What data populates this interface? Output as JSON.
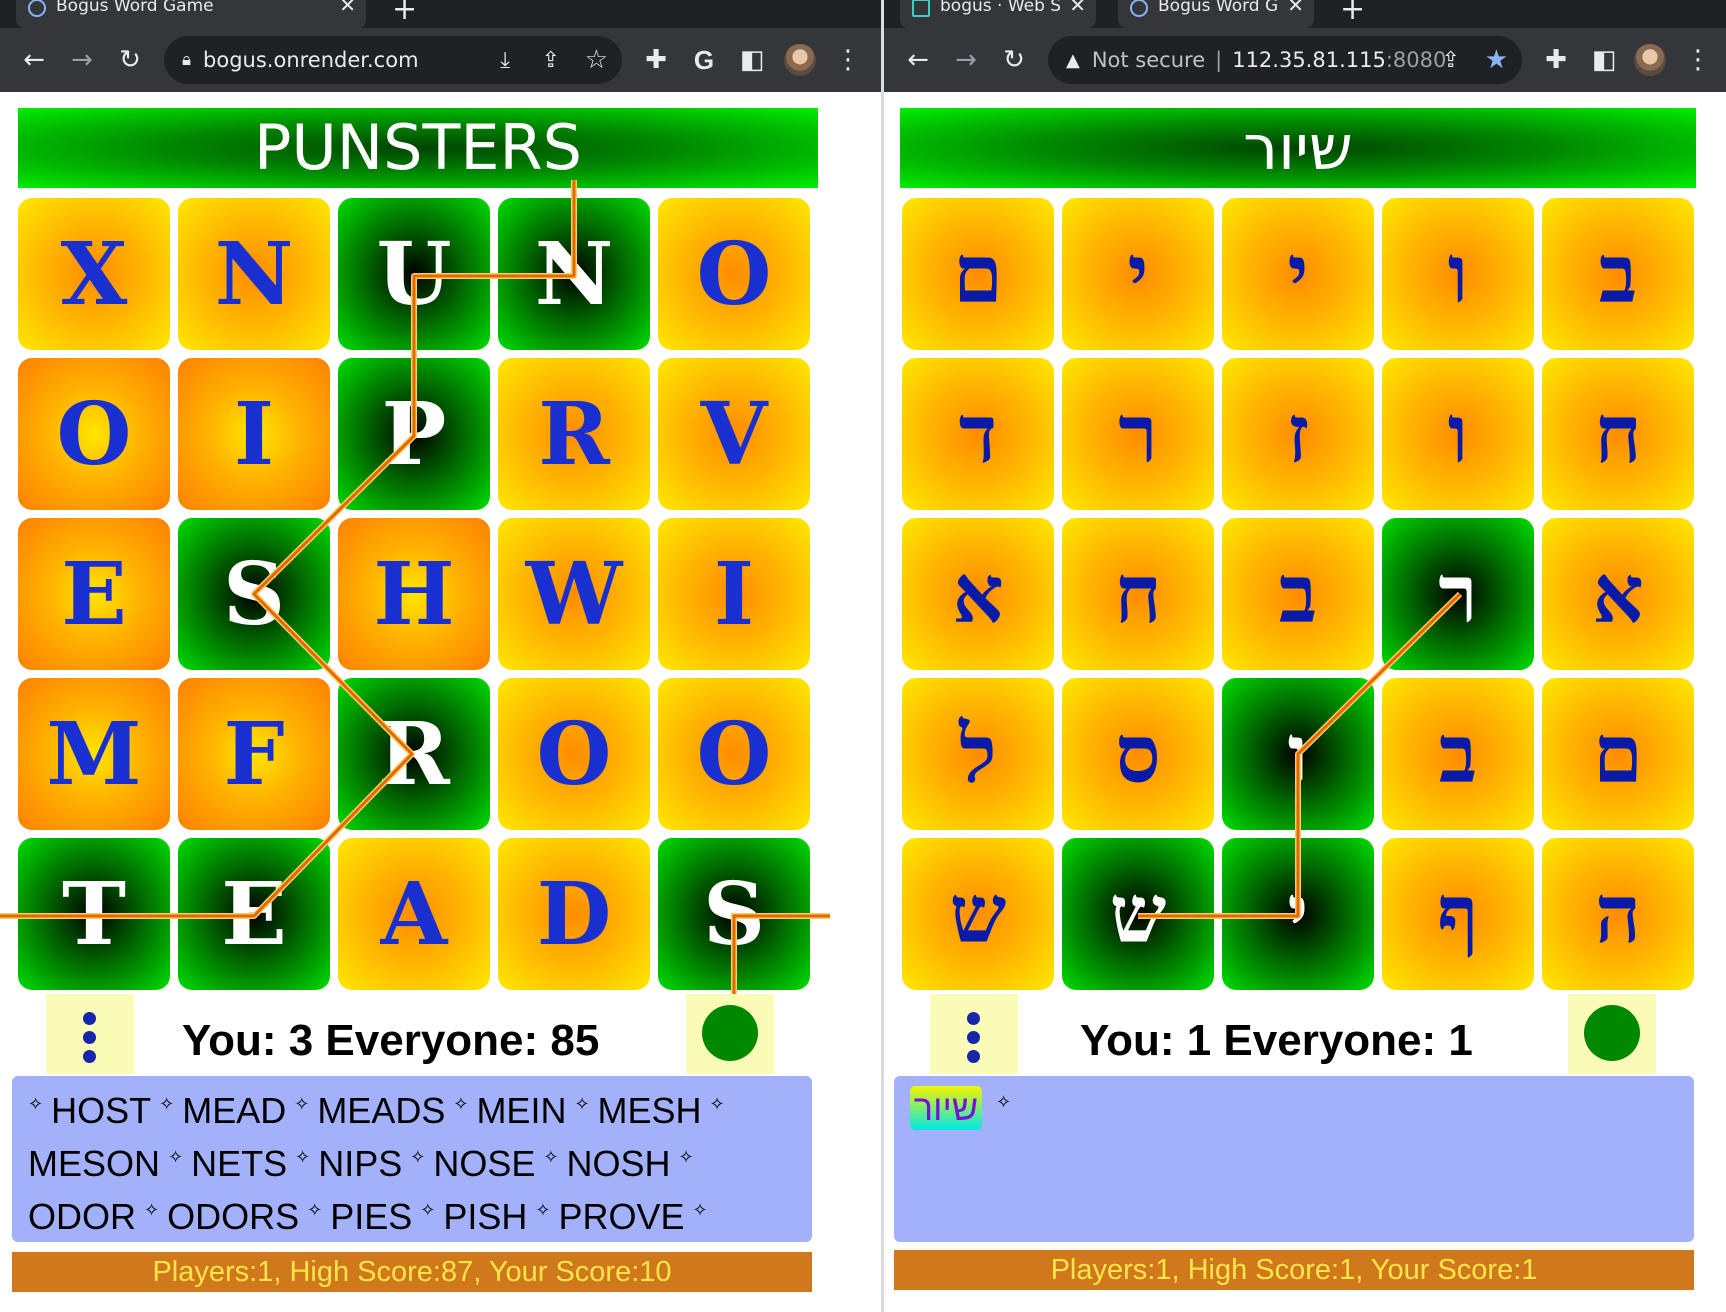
{
  "left": {
    "tabs": [
      {
        "title": "Bogus Word Game"
      }
    ],
    "url": "bogus.onrender.com",
    "game": {
      "title": "PUNSTERS",
      "grid": [
        [
          {
            "l": "X",
            "s": "yellow"
          },
          {
            "l": "N",
            "s": "yellow"
          },
          {
            "l": "U",
            "s": "green"
          },
          {
            "l": "N",
            "s": "green"
          },
          {
            "l": "O",
            "s": "yellow"
          }
        ],
        [
          {
            "l": "O",
            "s": "orange"
          },
          {
            "l": "I",
            "s": "orange"
          },
          {
            "l": "P",
            "s": "green"
          },
          {
            "l": "R",
            "s": "yellow"
          },
          {
            "l": "V",
            "s": "yellow"
          }
        ],
        [
          {
            "l": "E",
            "s": "orange"
          },
          {
            "l": "S",
            "s": "green"
          },
          {
            "l": "H",
            "s": "orange"
          },
          {
            "l": "W",
            "s": "yellow"
          },
          {
            "l": "I",
            "s": "yellow"
          }
        ],
        [
          {
            "l": "M",
            "s": "orange"
          },
          {
            "l": "F",
            "s": "orange"
          },
          {
            "l": "R",
            "s": "green"
          },
          {
            "l": "O",
            "s": "yellow"
          },
          {
            "l": "O",
            "s": "yellow"
          }
        ],
        [
          {
            "l": "T",
            "s": "green"
          },
          {
            "l": "E",
            "s": "green"
          },
          {
            "l": "A",
            "s": "yellow"
          },
          {
            "l": "D",
            "s": "yellow"
          },
          {
            "l": "S",
            "s": "green"
          }
        ]
      ],
      "score_text": "You: 3 Everyone: 85",
      "found_words": [
        [
          "HOST",
          "MEAD",
          "MEADS",
          "MEIN",
          "MESH"
        ],
        [
          "MESON",
          "NETS",
          "NIPS",
          "NOSE",
          "NOSH"
        ],
        [
          "ODOR",
          "ODORS",
          "PIES",
          "PISH",
          "PROVE"
        ]
      ],
      "separator": "✧",
      "footer": "Players:1, High Score:87, Your Score:10"
    }
  },
  "right": {
    "tabs": [
      {
        "title": "bogus · Web S"
      },
      {
        "title": "Bogus Word G"
      }
    ],
    "url_warning": "Not secure",
    "url": "112.35.81.115",
    "url_port": ":8080",
    "game": {
      "title": "שיור",
      "grid": [
        [
          {
            "l": "ם",
            "s": "yellow"
          },
          {
            "l": "י",
            "s": "yellow"
          },
          {
            "l": "י",
            "s": "yellow"
          },
          {
            "l": "ו",
            "s": "yellow"
          },
          {
            "l": "ב",
            "s": "yellow"
          }
        ],
        [
          {
            "l": "ד",
            "s": "yellow"
          },
          {
            "l": "ר",
            "s": "yellow"
          },
          {
            "l": "ז",
            "s": "yellow"
          },
          {
            "l": "ו",
            "s": "yellow"
          },
          {
            "l": "ח",
            "s": "yellow"
          }
        ],
        [
          {
            "l": "א",
            "s": "yellow"
          },
          {
            "l": "ח",
            "s": "yellow"
          },
          {
            "l": "ב",
            "s": "yellow"
          },
          {
            "l": "ר",
            "s": "green"
          },
          {
            "l": "א",
            "s": "yellow"
          }
        ],
        [
          {
            "l": "ל",
            "s": "yellow"
          },
          {
            "l": "ס",
            "s": "yellow"
          },
          {
            "l": "ו",
            "s": "green"
          },
          {
            "l": "ב",
            "s": "yellow"
          },
          {
            "l": "ם",
            "s": "yellow"
          }
        ],
        [
          {
            "l": "ש",
            "s": "yellow"
          },
          {
            "l": "ש",
            "s": "green"
          },
          {
            "l": "י",
            "s": "green"
          },
          {
            "l": "ף",
            "s": "yellow"
          },
          {
            "l": "ה",
            "s": "yellow"
          }
        ]
      ],
      "score_text": "You: 1 Everyone: 1",
      "found_words": [
        "שיור"
      ],
      "separator": "✧",
      "footer": "Players:1, High Score:1, Your Score:1"
    }
  },
  "icons": {
    "back": "←",
    "forward": "→",
    "reload": "↻",
    "extensions": "puzzle-icon",
    "star": "☆"
  }
}
